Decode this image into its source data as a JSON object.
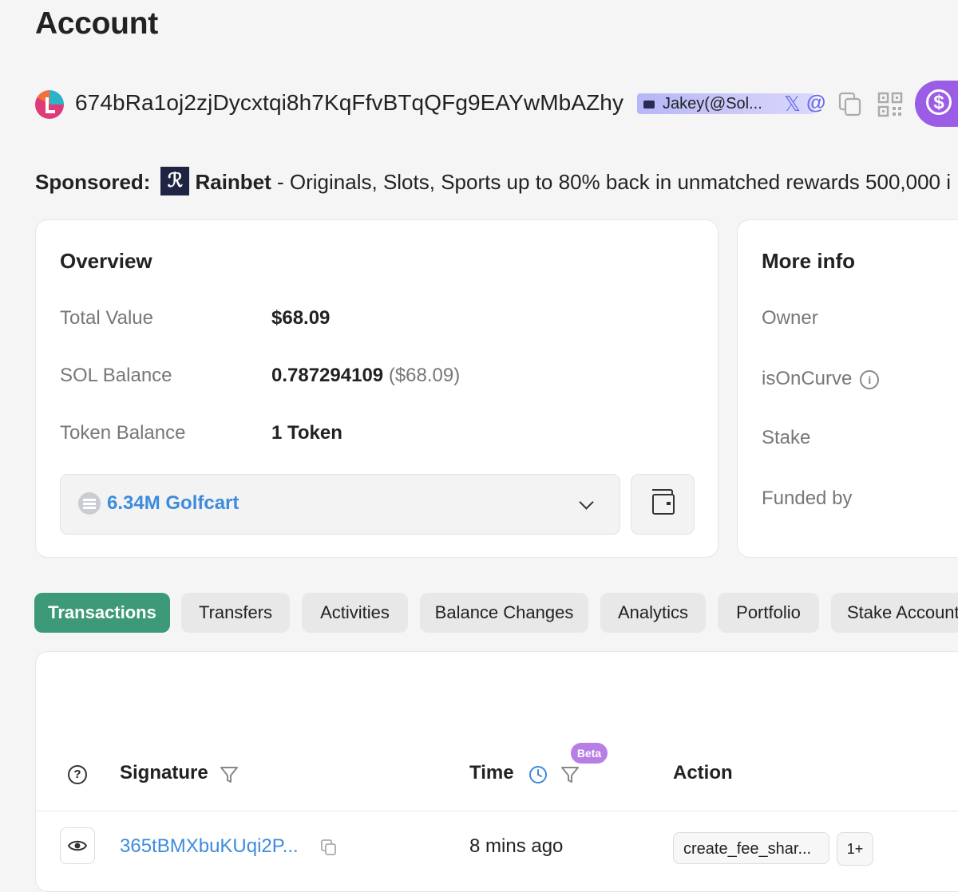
{
  "page": {
    "title": "Account"
  },
  "account": {
    "address": "674bRa1oj2zjDycxtqi8h7KqFfvBTqQFg9EAYwMbAZhy",
    "tag": "Jakey(@Sol..."
  },
  "sponsored": {
    "label": "Sponsored:",
    "brand": "Rainbet",
    "text": " - Originals, Slots, Sports up to 80% back in unmatched rewards 500,000 i"
  },
  "overview": {
    "title": "Overview",
    "rows": [
      {
        "label": "Total Value",
        "value": "$68.09"
      },
      {
        "label": "SOL Balance",
        "value": "0.787294109",
        "secondary": "($68.09)"
      },
      {
        "label": "Token Balance",
        "value": "1 Token"
      }
    ],
    "token_select": {
      "selected": "6.34M Golfcart"
    }
  },
  "more_info": {
    "title": "More info",
    "rows": [
      {
        "label": "Owner"
      },
      {
        "label": "isOnCurve"
      },
      {
        "label": "Stake"
      },
      {
        "label": "Funded by"
      }
    ]
  },
  "tabs": [
    {
      "label": "Transactions",
      "active": true
    },
    {
      "label": "Transfers"
    },
    {
      "label": "Activities"
    },
    {
      "label": "Balance Changes"
    },
    {
      "label": "Analytics"
    },
    {
      "label": "Portfolio"
    },
    {
      "label": "Stake Accounts"
    }
  ],
  "table": {
    "columns": {
      "signature": "Signature",
      "time": "Time",
      "action": "Action"
    },
    "beta_badge": "Beta",
    "rows": [
      {
        "signature": "365tBMXbuKUqi2P...",
        "time": "8 mins ago",
        "action": "create_fee_shar...",
        "more": "1+"
      }
    ]
  },
  "colors": {
    "accent_green": "#3d9a78",
    "link_blue": "#3d8bdd",
    "purple": "#9b5de5",
    "beta": "#b77ee6"
  },
  "icons": [
    "avatar-icon",
    "x-icon",
    "at-icon",
    "copy-icon",
    "qr-code-icon",
    "dollar-icon",
    "rainbet-logo",
    "coin-icon",
    "chevron-down-icon",
    "wallet-icon",
    "info-icon",
    "help-icon",
    "filter-icon",
    "clock-icon",
    "eye-icon"
  ]
}
